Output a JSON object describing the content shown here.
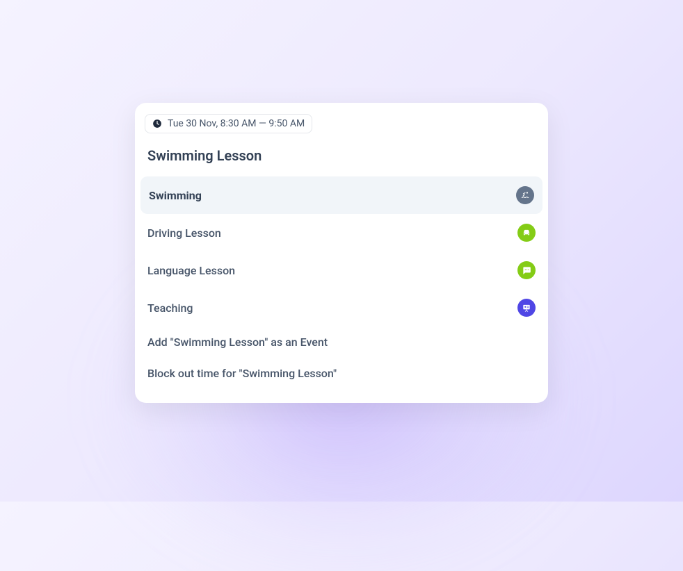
{
  "datetime": "Tue 30 Nov, 8:30 AM — 9:50 AM",
  "title": "Swimming Lesson",
  "options": [
    {
      "label": "Swimming",
      "icon": "swimming",
      "selected": true
    },
    {
      "label": "Driving Lesson",
      "icon": "driving",
      "selected": false
    },
    {
      "label": "Language Lesson",
      "icon": "language",
      "selected": false
    },
    {
      "label": "Teaching",
      "icon": "teaching",
      "selected": false
    }
  ],
  "actions": {
    "addEvent": "Add \"Swimming Lesson\" as an Event",
    "blockTime": "Block out time for \"Swimming Lesson\""
  }
}
